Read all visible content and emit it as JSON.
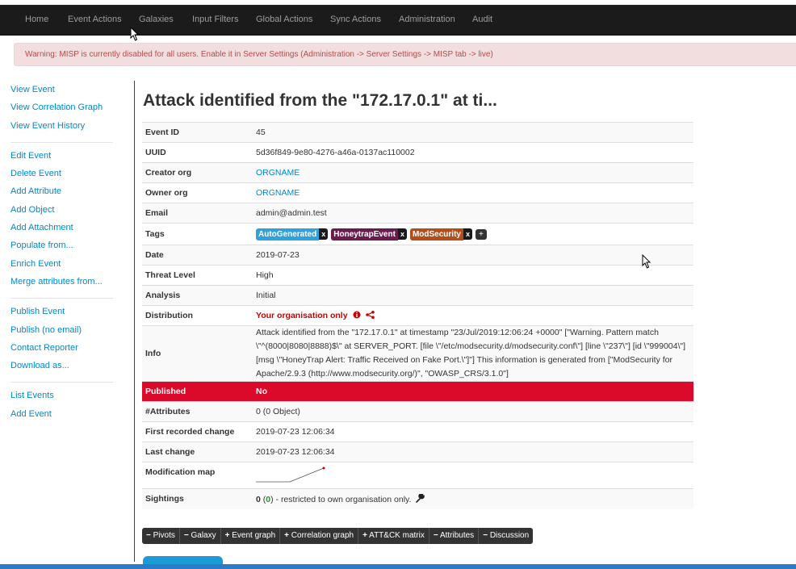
{
  "nav": [
    "Home",
    "Event Actions",
    "Galaxies",
    "Input Filters",
    "Global Actions",
    "Sync Actions",
    "Administration",
    "Audit"
  ],
  "warning": "Warning: MISP is currently disabled for all users. Enable it in Server Settings (Administration -> Server Settings -> MISP tab -> live)",
  "sidebar": {
    "group1": [
      "View Event",
      "View Correlation Graph",
      "View Event History"
    ],
    "group2": [
      "Edit Event",
      "Delete Event",
      "Add Attribute",
      "Add Object",
      "Add Attachment",
      "Populate from...",
      "Enrich Event",
      "Merge attributes from..."
    ],
    "group3": [
      "Publish Event",
      "Publish (no email)",
      "Contact Reporter",
      "Download as..."
    ],
    "group4": [
      "List Events",
      "Add Event"
    ]
  },
  "title": "Attack identified from the \"172.17.0.1\" at ti...",
  "event": {
    "event_id_label": "Event ID",
    "event_id": "45",
    "uuid_label": "UUID",
    "uuid": "5d36f849-9e80-4276-a46a-0137ac110002",
    "creator_org_label": "Creator org",
    "creator_org": "ORGNAME",
    "owner_org_label": "Owner org",
    "owner_org": "ORGNAME",
    "email_label": "Email",
    "email": "admin@admin.test",
    "tags_label": "Tags",
    "tags": [
      {
        "name": "AutoGenerated",
        "color": "#2fa1db"
      },
      {
        "name": "HoneytrapEvent",
        "color": "#6b1c4f"
      },
      {
        "name": "ModSecurity",
        "color": "#b44e17"
      }
    ],
    "tag_remove": "x",
    "tag_add": "+",
    "date_label": "Date",
    "date": "2019-07-23",
    "threat_label": "Threat Level",
    "threat": "High",
    "analysis_label": "Analysis",
    "analysis": "Initial",
    "distribution_label": "Distribution",
    "distribution": "Your organisation only",
    "info_label": "Info",
    "info": "Attack identified from the \"172.17.0.1\" at timestamp \"23/Jul/2019:12:06:24 +0000\" [\"Warning. Pattern match \\\"^(8000|8080|8888)$\\\" at SERVER_PORT. [file \\\"/etc/modsecurity.d/modsecurity.conf\\\"] [line \\\"237\\\"] [id \\\"999004\\\"] [msg \\\"HoneyTrap Alert: Traffic Received on Fake Port.\\\"]\"] This information is generated from [\"ModSecurity for Apache/2.9.3 (http://www.modsecurity.org/)\", \"OWASP_CRS/3.1.0\"]",
    "published_label": "Published",
    "published": "No",
    "attributes_label": "#Attributes",
    "attributes": "0 (0 Object)",
    "first_change_label": "First recorded change",
    "first_change": "2019-07-23 12:06:34",
    "last_change_label": "Last change",
    "last_change": "2019-07-23 12:06:34",
    "modmap_label": "Modification map",
    "sightings_label": "Sightings",
    "sightings_count": "0",
    "sightings_own": "0",
    "sightings_note": " - restricted to own organisation only."
  },
  "buttons": [
    "Pivots",
    "Galaxy",
    "Event graph",
    "Correlation graph",
    "ATT&CK matrix",
    "Attributes",
    "Discussion"
  ],
  "button_signs": [
    "−",
    "−",
    "+",
    "+",
    "+",
    "−",
    "−"
  ],
  "colors": {
    "nav_bg": "#1b1b1b",
    "published_bg": "#dc0a2a",
    "link": "#0088cc"
  }
}
